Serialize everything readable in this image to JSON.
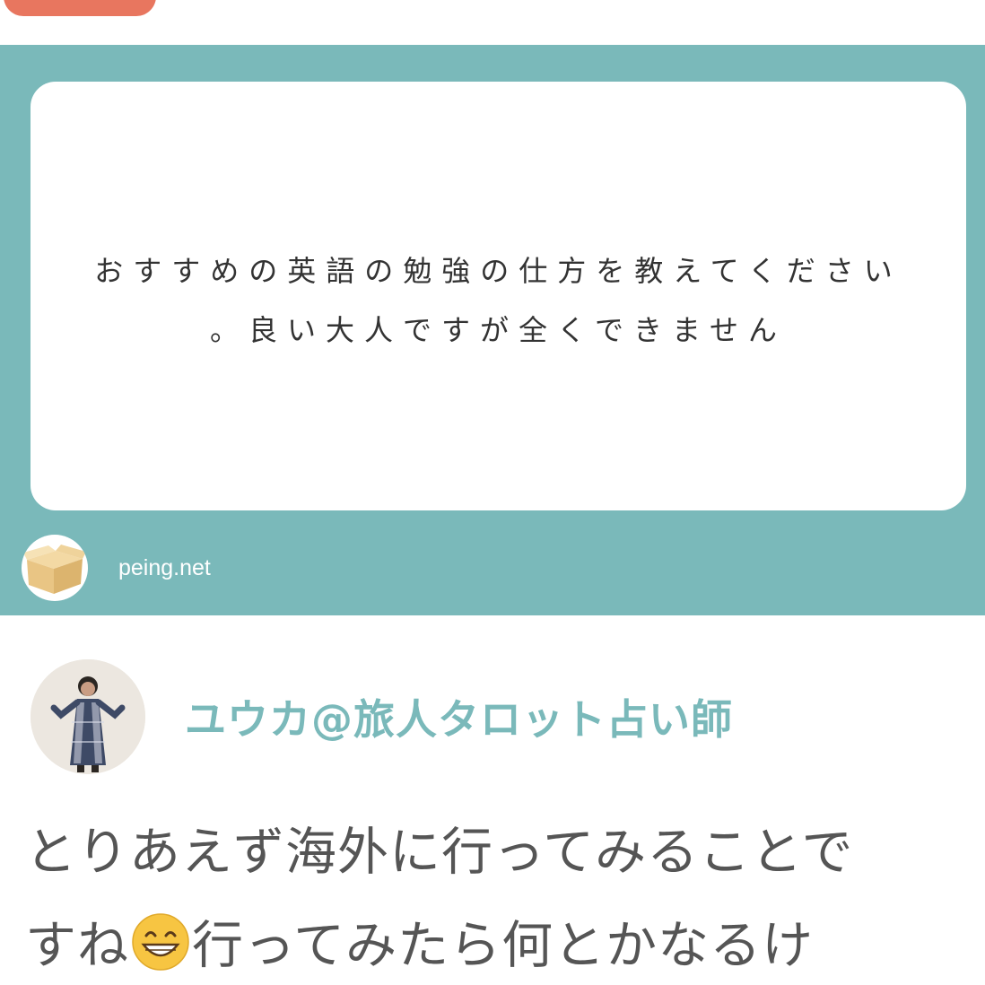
{
  "question": {
    "line1": "おすすめの英語の勉強の仕方を教えてください",
    "line2": "。良い大人ですが全くできません"
  },
  "site": {
    "label": "peing.net",
    "logo_icon": "cardboard-box-icon"
  },
  "author": {
    "name": "ユウカ@旅人タロット占い師",
    "avatar_icon": "person-photo-avatar"
  },
  "answer": {
    "line1": "とりあえず海外に行ってみることで",
    "line2_before": "すね",
    "emoji_icon": "grinning-face-emoji",
    "line2_after": "行ってみたら何とかなるけ"
  },
  "colors": {
    "card_background": "#7ab9ba",
    "author_name": "#7ab9ba",
    "top_tag": "#e8765f",
    "answer_text": "#555555"
  }
}
